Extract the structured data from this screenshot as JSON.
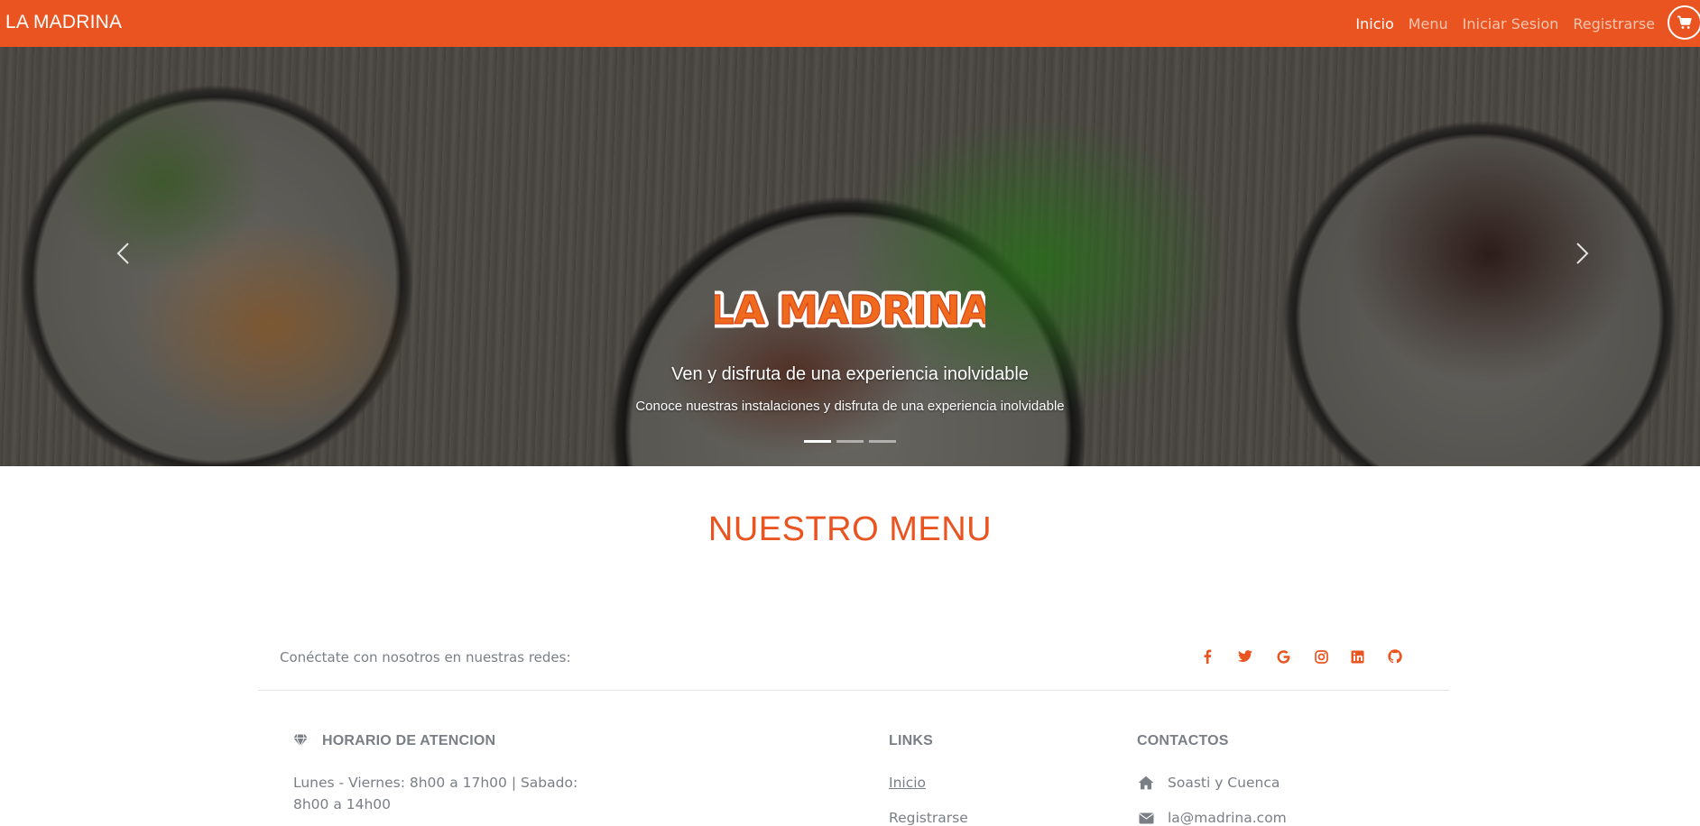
{
  "navbar": {
    "brand": "LA MADRINA",
    "items": [
      {
        "label": "Inicio",
        "active": true
      },
      {
        "label": "Menu",
        "active": false
      },
      {
        "label": "Iniciar Sesion",
        "active": false
      },
      {
        "label": "Registrarse",
        "active": false
      }
    ],
    "cart_icon": "shopping-cart-icon",
    "color": "#e95420"
  },
  "carousel": {
    "logo_text": "LA MADRINA",
    "caption_title": "Ven y disfruta de una experiencia inolvidable",
    "caption_text": "Conoce nuestras instalaciones y disfruta de una experiencia inolvidable",
    "slides_count": 3,
    "active_slide": 1,
    "prev_icon": "chevron-left-icon",
    "next_icon": "chevron-right-icon"
  },
  "menu_section": {
    "title": "NUESTRO MENU"
  },
  "footer": {
    "social_text": "Conéctate con nosotros en nuestras redes:",
    "social_icons": [
      "facebook-icon",
      "twitter-icon",
      "google-icon",
      "instagram-icon",
      "linkedin-icon",
      "github-icon"
    ],
    "accent": "#e95420",
    "horario": {
      "icon": "gem-icon",
      "title": "HORARIO DE ATENCION",
      "line1": "Lunes - Viernes: 8h00 a 17h00 | Sabado:",
      "line2": "8h00 a 14h00"
    },
    "links": {
      "title": "LINKS",
      "items": [
        "Inicio",
        "Registrarse"
      ]
    },
    "contactos": {
      "title": "CONTACTOS",
      "items": [
        {
          "icon": "home-icon",
          "text": "Soasti y Cuenca"
        },
        {
          "icon": "envelope-icon",
          "text": "la@madrina.com"
        }
      ]
    }
  }
}
